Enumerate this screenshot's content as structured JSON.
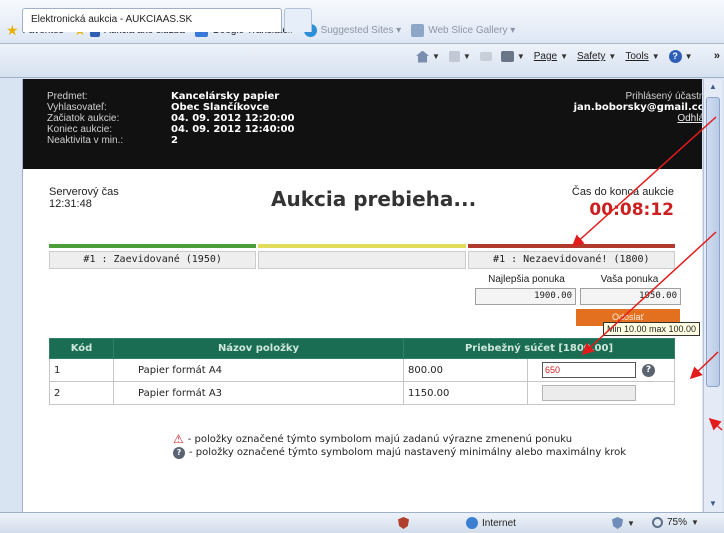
{
  "browser": {
    "favorites_label": "Favorites",
    "fav_links": [
      {
        "label": "Aukcia ako služba"
      },
      {
        "label": "Google Translate#"
      },
      {
        "label": "Suggested Sites ▾"
      },
      {
        "label": "Web Slice Gallery ▾"
      }
    ],
    "tab_title": "Elektronická aukcia - AUKCIAAS.SK",
    "cmd_page": "Page",
    "cmd_safety": "Safety",
    "cmd_tools": "Tools",
    "overflow": "»",
    "status_zone": "Internet",
    "zoom": "75%"
  },
  "header": {
    "labels": [
      "Predmet:",
      "Vyhlasovateľ:",
      "Začiatok aukcie:",
      "Koniec aukcie:",
      "Neaktivita v min.:"
    ],
    "values": [
      "Kancelársky papier",
      "Obec Slančíkovce",
      "04. 09. 2012 12:20:00",
      "04. 09. 2012 12:40:00",
      "2"
    ],
    "participant_label": "Prihlásený účastník:",
    "participant_email": "jan.boborsky@gmail.com",
    "logout": "Odhlásiť"
  },
  "auction": {
    "server_time_label": "Serverový čas",
    "server_time": "12:31:48",
    "status": "Aukcia prebieha...",
    "countdown_label": "Čas do konca aukcie",
    "countdown": "00:08:12",
    "bar_colors": [
      "#4b9e3a",
      "#e1dc5a",
      "#b03a2e"
    ],
    "bid_cells": [
      "#1 : Zaevidované (1950)",
      "",
      "#1 : Nezaevidované! (1800)"
    ],
    "best_offer_label": "Najlepšia ponuka",
    "your_offer_label": "Vaša ponuka",
    "best_offer": "1900.00",
    "your_offer": "1950.00",
    "submit": "Odoslať"
  },
  "table": {
    "headers": [
      "Kód",
      "Názov položky",
      "Priebežný súčet [1800.00]"
    ],
    "rows": [
      {
        "code": "1",
        "name": "Papier formát A4",
        "sum": "800.00",
        "input": "650"
      },
      {
        "code": "2",
        "name": "Papier formát A3",
        "sum": "1150.00",
        "input": ""
      }
    ],
    "tooltip": "Min 10.00 max 100.00"
  },
  "legend": {
    "warn": "- položky označené týmto symbolom majú zadanú výrazne zmenenú ponuku",
    "help": "- položky označené týmto symbolom majú nastavený minimálny alebo maximálny krok"
  },
  "colors": {
    "header_bg": "#111111",
    "table_header": "#1a6d52",
    "countdown": "#cc1f1f",
    "submit": "#e2701f",
    "annotation_arrow": "#e31b1b"
  }
}
